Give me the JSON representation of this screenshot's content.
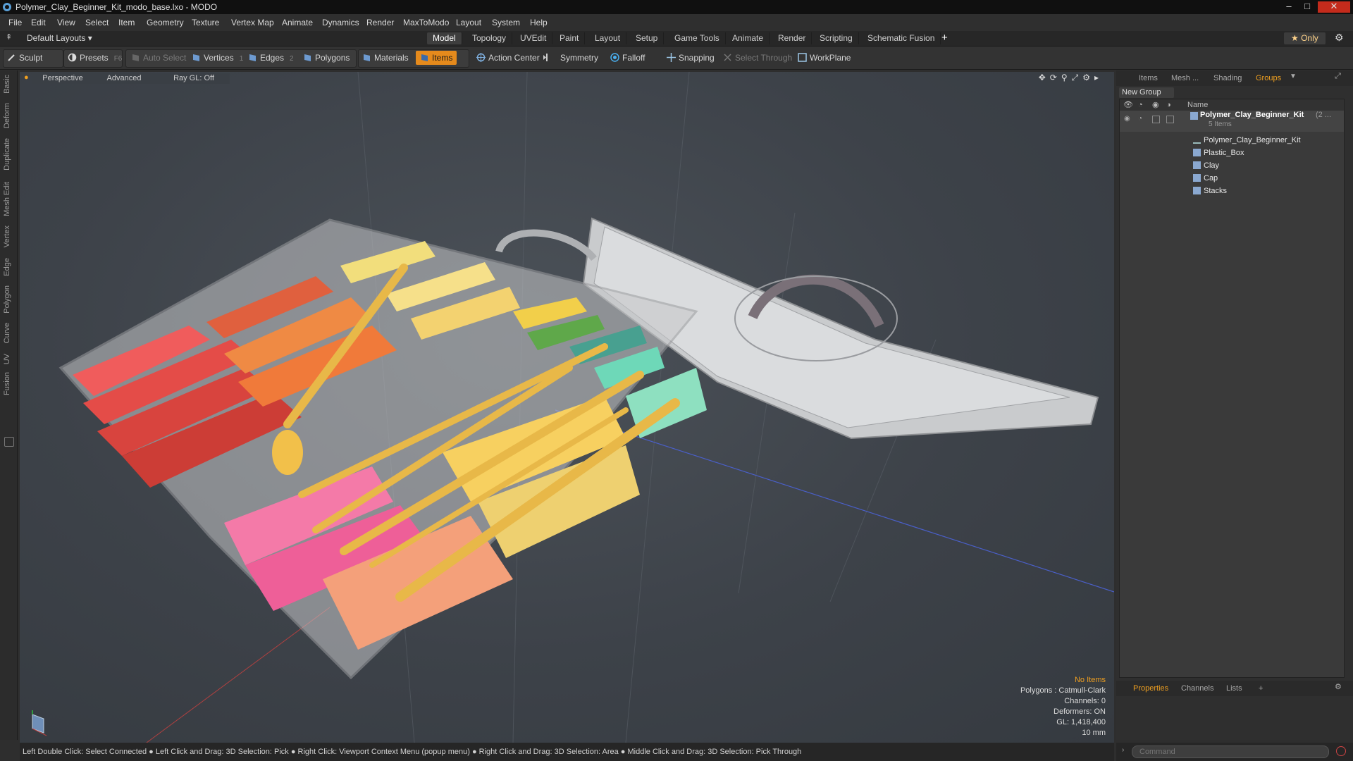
{
  "window": {
    "title": "Polymer_Clay_Beginner_Kit_modo_base.lxo - MODO",
    "controls": [
      "–",
      "□",
      "✕"
    ]
  },
  "menu": [
    "File",
    "Edit",
    "View",
    "Select",
    "Item",
    "Geometry",
    "Texture",
    "Vertex Map",
    "Animate",
    "Dynamics",
    "Render",
    "MaxToModo",
    "Layout",
    "System",
    "Help"
  ],
  "layout_selector": "Default Layouts ▾",
  "layout_tabs": [
    "Model",
    "Topology",
    "UVEdit",
    "Paint",
    "Layout",
    "Setup",
    "Game Tools",
    "Animate",
    "Render",
    "Scripting",
    "Schematic Fusion"
  ],
  "active_layout_tab": "Model",
  "add_tab": "+",
  "only_label": "★ Only",
  "toolbar": {
    "sculpt": "Sculpt",
    "presets": "Presets",
    "presets_key": "F6",
    "auto_select": "Auto Select",
    "vertices": "Vertices",
    "vertices_count": "1",
    "edges": "Edges",
    "edges_count": "2",
    "polygons": "Polygons",
    "materials": "Materials",
    "items": "Items",
    "action_center": "Action Center",
    "symmetry": "Symmetry",
    "falloff": "Falloff",
    "snapping": "Snapping",
    "select_through": "Select Through",
    "workplane": "WorkPlane"
  },
  "left_tabs": [
    "Basic",
    "Deform",
    "Duplicate",
    "Mesh Edit",
    "Vertex",
    "Edge",
    "Polygon",
    "Curve",
    "UV",
    "Fusion"
  ],
  "viewport": {
    "perspective": "Perspective",
    "advanced": "Advanced",
    "raygl": "Ray GL: Off",
    "stats": {
      "no_items": "No Items",
      "polygons": "Polygons : Catmull-Clark",
      "channels": "Channels: 0",
      "deformers": "Deformers: ON",
      "gl": "GL: 1,418,400",
      "unit": "10 mm"
    }
  },
  "right_panel": {
    "tabs": [
      "Items",
      "Mesh ...",
      "Shading",
      "Groups"
    ],
    "active_tab": "Groups",
    "new_group": "New Group",
    "name_header": "Name",
    "root": {
      "label": "Polymer_Clay_Beginner_Kit",
      "count": "(2 ...",
      "sub": "5 Items"
    },
    "children": [
      "Polymer_Clay_Beginner_Kit",
      "Plastic_Box",
      "Clay",
      "Cap",
      "Stacks"
    ],
    "bottom_tabs": [
      "Properties",
      "Channels",
      "Lists",
      "+"
    ],
    "active_bottom_tab": "Properties"
  },
  "status_bar": "Left Double Click: Select Connected ● Left Click and Drag: 3D Selection: Pick ● Right Click: Viewport Context Menu (popup menu) ● Right Click and Drag: 3D Selection: Area ● Middle Click and Drag: 3D Selection: Pick Through",
  "command_placeholder": "Command",
  "colors": {
    "accent": "#e58a1c",
    "highlight_text": "#f0a020",
    "bg": "#2e2e2e",
    "viewport": "#40454b"
  }
}
